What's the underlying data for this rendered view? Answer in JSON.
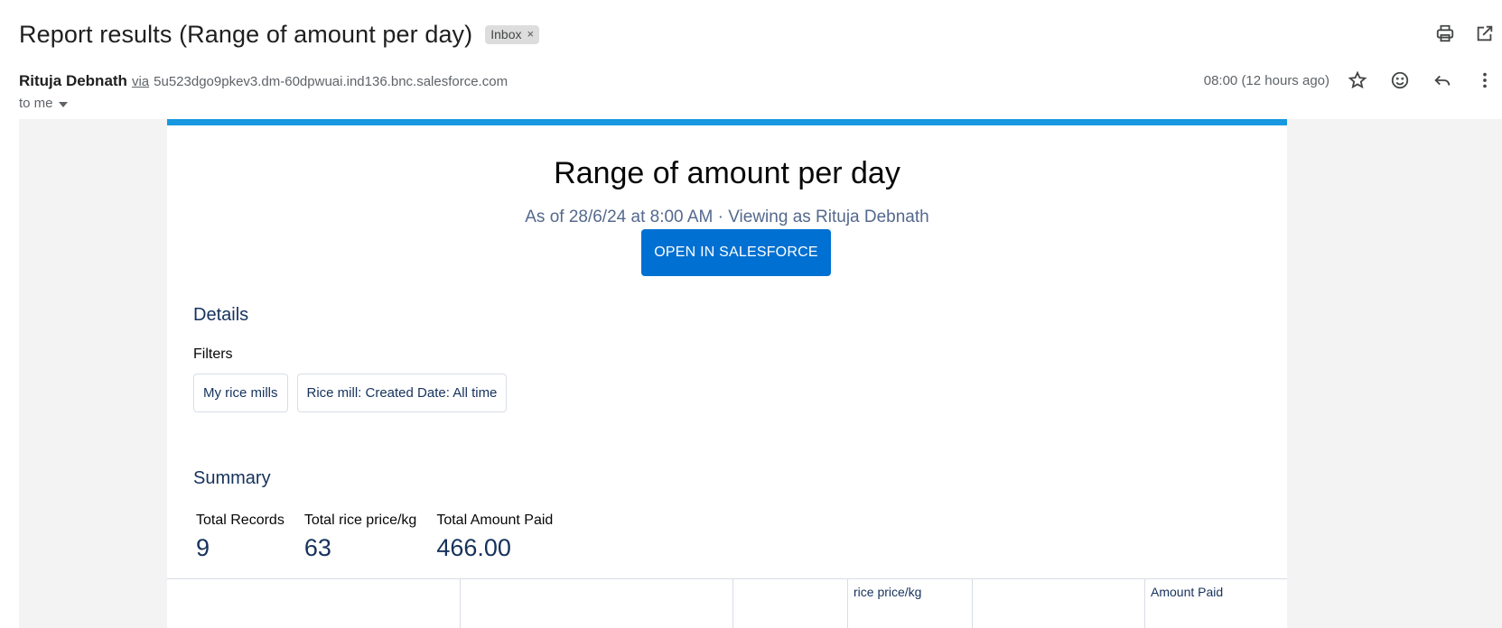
{
  "email": {
    "subject": "Report results (Range of amount per day)",
    "label": "Inbox",
    "label_remove": "×",
    "sender_name": "Rituja Debnath",
    "via": "via",
    "sender_email": "5u523dgo9pkev3.dm-60dpwuai.ind136.bnc.salesforce.com",
    "to": "to me",
    "timestamp": "08:00 (12 hours ago)"
  },
  "icons": {
    "top": [
      "print-icon",
      "open-in-new-window-icon"
    ],
    "meta": [
      "star-icon",
      "emoji-icon",
      "reply-icon",
      "more-vert-icon"
    ]
  },
  "report": {
    "title": "Range of amount per day",
    "subtitle": "As of 28/6/24 at 8:00 AM · Viewing as Rituja Debnath",
    "open_button": "OPEN IN SALESFORCE",
    "details_heading": "Details",
    "filters_label": "Filters",
    "filters": [
      "My rice mills",
      "Rice mill: Created Date: All time"
    ],
    "summary_heading": "Summary",
    "summary": [
      {
        "label": "Total Records",
        "value": "9"
      },
      {
        "label": "Total rice price/kg",
        "value": "63"
      },
      {
        "label": "Total Amount Paid",
        "value": "466.00"
      }
    ],
    "table_headers": [
      "",
      "",
      "",
      "rice price/kg",
      "",
      "Amount Paid"
    ]
  },
  "colors": {
    "accent_bar": "#1798e0",
    "button": "#0070d2",
    "heading_navy": "#16325c",
    "subtitle": "#54698d",
    "canvas_bg": "#f3f3f3"
  }
}
